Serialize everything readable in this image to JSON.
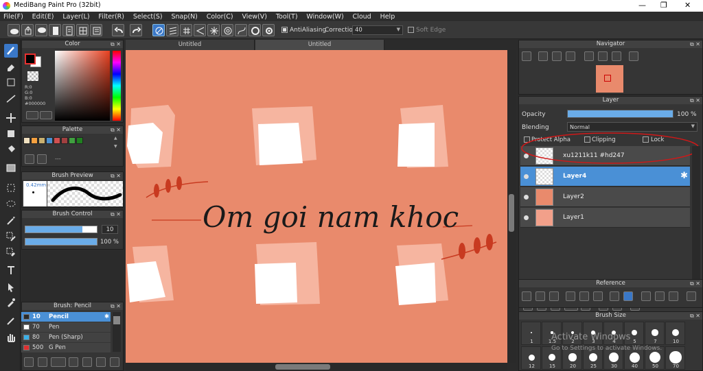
{
  "app": {
    "title": "MediBang Paint Pro (32bit)"
  },
  "menu": [
    "File(F)",
    "Edit(E)",
    "Layer(L)",
    "Filter(R)",
    "Select(S)",
    "Snap(N)",
    "Color(C)",
    "View(V)",
    "Tool(T)",
    "Window(W)",
    "Cloud",
    "Help"
  ],
  "toolbar": {
    "antialiasing": "AntiAliasing",
    "correction_label": "Correction",
    "correction_value": "40",
    "soft_edge": "Soft Edge"
  },
  "tabs": [
    "Untitled",
    "Untitled"
  ],
  "color_panel": {
    "title": "Color",
    "r": "R:0",
    "g": "G:0",
    "b": "B:0",
    "hex": "#000000",
    "fg": "#000000",
    "bg": "#ffffff",
    "accent": "#e83030"
  },
  "palette": {
    "title": "Palette",
    "swatches": [
      "#f0e0c0",
      "#f4a040",
      "#c8b070",
      "#4a90d0",
      "#d05050",
      "#a04040",
      "#40a040",
      "#208020"
    ],
    "dash": "---"
  },
  "brush_preview": {
    "title": "Brush Preview",
    "size": "0.42mm"
  },
  "brush_control": {
    "title": "Brush Control",
    "size": "10",
    "opacity": "100 %",
    "size_fill": 0.8,
    "opacity_fill": 1.0
  },
  "brush_list": {
    "title": "Brush: Pencil",
    "items": [
      {
        "num": "10",
        "name": "Pencil",
        "color": "#2a2a2a",
        "selected": true
      },
      {
        "num": "70",
        "name": "Pen",
        "color": "#ffffff"
      },
      {
        "num": "80",
        "name": "Pen (Sharp)",
        "color": "#3ab0e8"
      },
      {
        "num": "500",
        "name": "G Pen",
        "color": "#e03030"
      }
    ]
  },
  "canvas": {
    "text": "Om goi nam khoc",
    "bg": "#e98a6c"
  },
  "navigator": {
    "title": "Navigator"
  },
  "layer_panel": {
    "title": "Layer",
    "opacity_label": "Opacity",
    "opacity_value": "100 %",
    "opacity_fill": 1.0,
    "blending_label": "Blending",
    "blending_value": "Normal",
    "protect_alpha": "Protect Alpha",
    "clipping": "Clipping",
    "lock": "Lock",
    "layers": [
      {
        "name": "xu1211k11 #hd247",
        "selected": false
      },
      {
        "name": "Layer4",
        "selected": true
      },
      {
        "name": "Layer2",
        "selected": false
      },
      {
        "name": "Layer1",
        "selected": false
      }
    ]
  },
  "reference": {
    "title": "Reference"
  },
  "brush_size": {
    "title": "Brush Size",
    "row1": [
      "1",
      "1.5",
      "2",
      "3",
      "4",
      "5",
      "7",
      "10"
    ],
    "row2": [
      "12",
      "15",
      "20",
      "25",
      "30",
      "40",
      "50",
      "70"
    ]
  },
  "watermark": {
    "line1": "Activate Windows",
    "line2": "Go to Settings to activate Windows."
  }
}
